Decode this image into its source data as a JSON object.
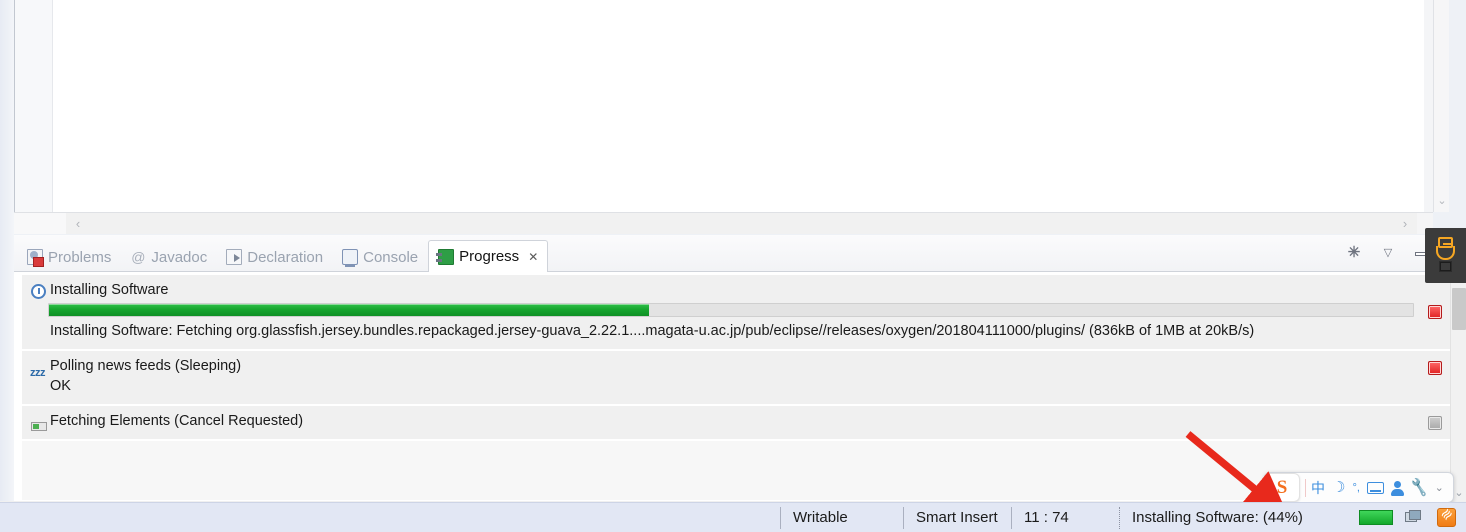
{
  "editor": {
    "hscroll_left_arrow": "‹",
    "hscroll_right_arrow": "›",
    "vscroll_chevron": "⌄"
  },
  "view_tabs": [
    {
      "label": "Problems",
      "icon": "problems-icon",
      "active": false
    },
    {
      "label": "Javadoc",
      "icon": "javadoc-icon",
      "active": false
    },
    {
      "label": "Declaration",
      "icon": "declaration-icon",
      "active": false
    },
    {
      "label": "Console",
      "icon": "console-icon",
      "active": false
    },
    {
      "label": "Progress",
      "icon": "progress-icon",
      "active": true,
      "close": "✕"
    }
  ],
  "view_toolbar": {
    "kill_label": "✳",
    "menu_label": "▽",
    "minimize_label": "—"
  },
  "progress": {
    "jobs": [
      {
        "title": "Installing Software",
        "icon": "clock-icon",
        "has_progress_bar": true,
        "percent": 44,
        "detail": "Installing Software: Fetching org.glassfish.jersey.bundles.repackaged.jersey-guava_2.22.1....magata-u.ac.jp/pub/eclipse//releases/oxygen/201804111000/plugins/ (836kB of 1MB at 20kB/s)",
        "stop_state": "active"
      },
      {
        "title": "Polling news feeds (Sleeping)",
        "icon": "zzz-icon",
        "has_progress_bar": false,
        "detail": "OK",
        "stop_state": "active"
      },
      {
        "title": "Fetching Elements (Cancel Requested)",
        "icon": "task-icon",
        "has_progress_bar": false,
        "detail": "",
        "stop_state": "disabled"
      }
    ],
    "scroll_up": "⌃",
    "scroll_down": "⌄"
  },
  "statusbar": {
    "writable": "Writable",
    "insert_mode": "Smart Insert",
    "cursor_position": "11 : 74",
    "job_status": "Installing Software: (44%)",
    "tray": {
      "green_indicator": "network-indicator-icon",
      "windows_stack": "window-stack-icon",
      "rss": "rss-feed-icon"
    }
  },
  "ime": {
    "logo": "S",
    "items": [
      {
        "name": "language-mode",
        "glyph": "中"
      },
      {
        "name": "moon-mode",
        "glyph": "🌙"
      },
      {
        "name": "punctuation-mode",
        "glyph": "°,"
      },
      {
        "name": "soft-keyboard",
        "glyph": ""
      },
      {
        "name": "user-profile",
        "glyph": ""
      },
      {
        "name": "toolbox",
        "glyph": "🔧"
      }
    ],
    "caret": "⌄"
  },
  "notification": {
    "icon": "usb-drive-icon"
  },
  "colors": {
    "progress_green": "#17a62f",
    "stop_red": "#e02020",
    "statusbar_bg": "#e2e7f4",
    "ime_blue": "#3d8ede",
    "annotation_red": "#e8291c"
  }
}
